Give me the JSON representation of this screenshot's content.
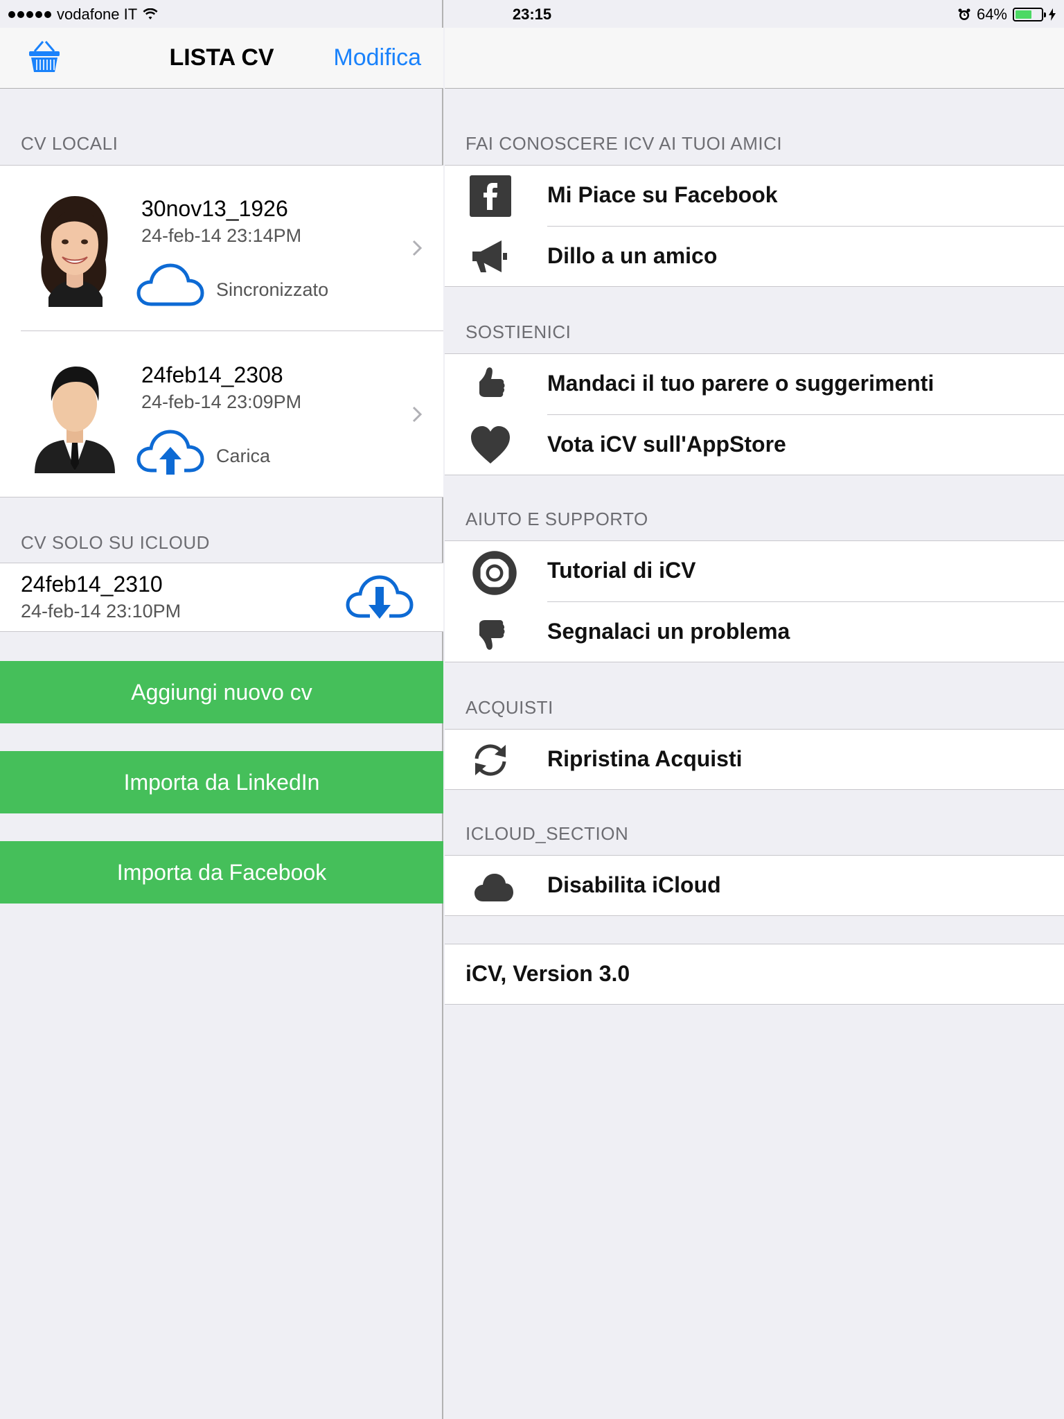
{
  "status": {
    "carrier": "vodafone IT",
    "time": "23:15",
    "battery": "64%",
    "battery_level": 0.64
  },
  "nav": {
    "title": "LISTA CV",
    "edit": "Modifica"
  },
  "local": {
    "header": "CV LOCALI",
    "items": [
      {
        "name": "30nov13_1926",
        "date": "24-feb-14 23:14PM",
        "status": "Sincronizzato"
      },
      {
        "name": "24feb14_2308",
        "date": "24-feb-14 23:09PM",
        "status": "Carica"
      }
    ]
  },
  "icloud_only": {
    "header": "CV SOLO SU ICLOUD",
    "items": [
      {
        "name": "24feb14_2310",
        "date": "24-feb-14 23:10PM"
      }
    ]
  },
  "actions": {
    "add": "Aggiungi nuovo cv",
    "linkedin": "Importa da LinkedIn",
    "facebook": "Importa da Facebook"
  },
  "menu": {
    "share": {
      "header": "FAI CONOSCERE ICV AI TUOI AMICI",
      "items": [
        {
          "label": "Mi Piace su Facebook",
          "icon": "facebook-icon"
        },
        {
          "label": "Dillo a un amico",
          "icon": "megaphone-icon"
        }
      ]
    },
    "support_us": {
      "header": "SOSTIENICI",
      "items": [
        {
          "label": "Mandaci il tuo parere o suggerimenti",
          "icon": "thumbs-up-icon"
        },
        {
          "label": "Vota iCV sull'AppStore",
          "icon": "heart-icon"
        }
      ]
    },
    "help": {
      "header": "AIUTO E SUPPORTO",
      "items": [
        {
          "label": "Tutorial di iCV",
          "icon": "lifebuoy-icon"
        },
        {
          "label": "Segnalaci un problema",
          "icon": "thumbs-down-icon"
        }
      ]
    },
    "purchases": {
      "header": "ACQUISTI",
      "items": [
        {
          "label": "Ripristina Acquisti",
          "icon": "refresh-icon"
        }
      ]
    },
    "icloud": {
      "header": "ICLOUD_SECTION",
      "items": [
        {
          "label": "Disabilita iCloud",
          "icon": "cloud-icon"
        }
      ]
    },
    "version": "iCV, Version 3.0"
  },
  "colors": {
    "accent": "#1a82fb",
    "green": "#45bf5a",
    "cloud_blue": "#0d6ad4",
    "icon_dark": "#3a3a3a"
  }
}
